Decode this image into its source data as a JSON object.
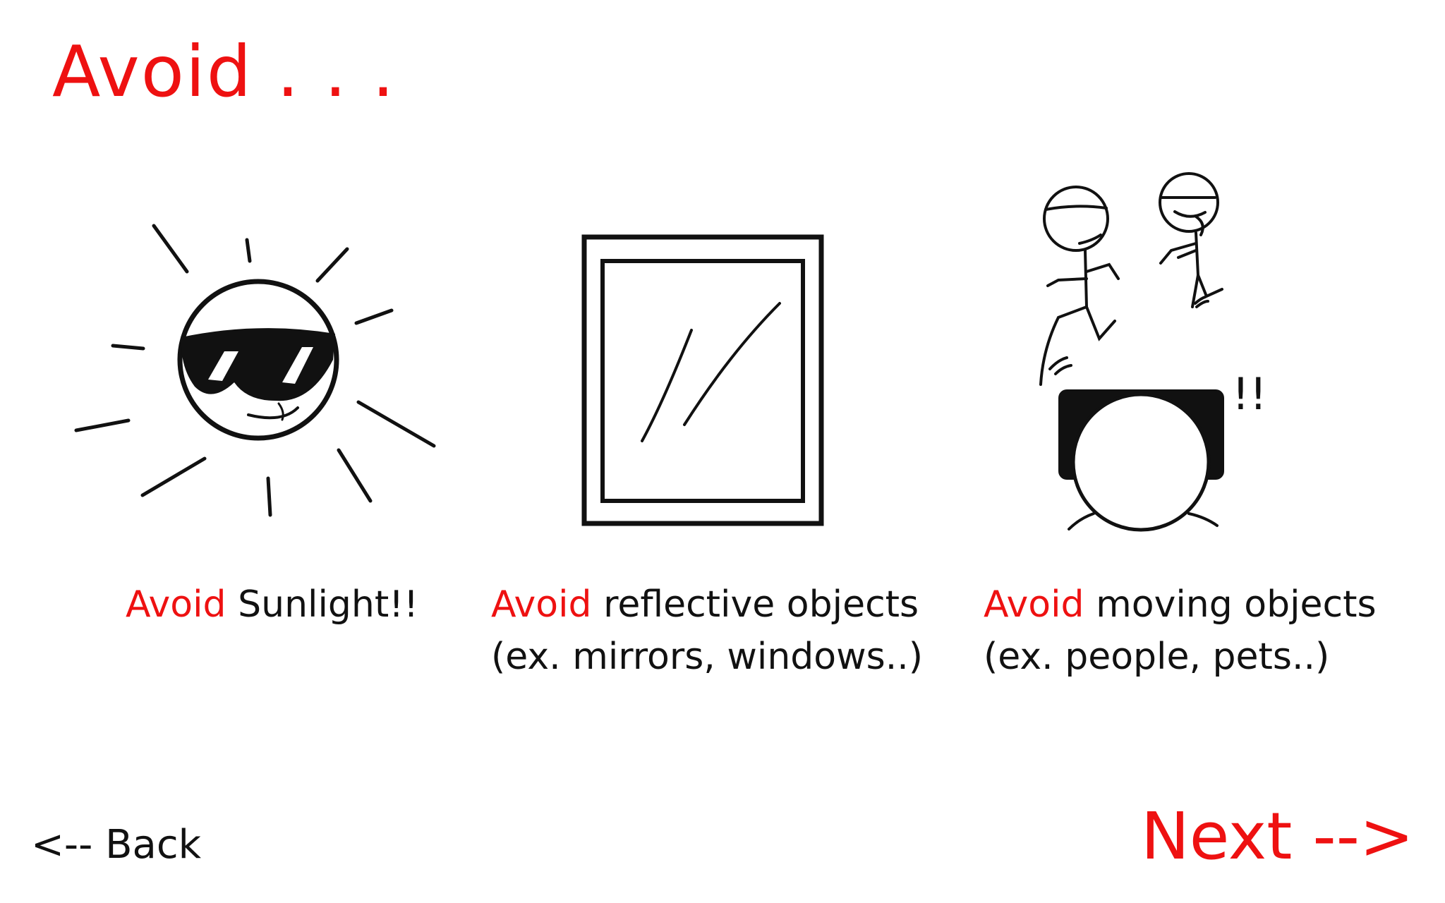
{
  "page": {
    "title": "Avoid . . ."
  },
  "items": [
    {
      "icon": "sun-with-sunglasses-icon",
      "accent": "Avoid",
      "line1": " Sunlight!!",
      "line2": ""
    },
    {
      "icon": "mirror-icon",
      "accent": "Avoid",
      "line1": " reflective objects",
      "line2": "(ex. mirrors, windows..)"
    },
    {
      "icon": "moving-people-icon",
      "accent": "Avoid",
      "line1": " moving objects",
      "line2": "(ex. people, pets..)"
    }
  ],
  "alert_mark": "!!",
  "nav": {
    "back_label": "<-- Back",
    "next_label": "Next -->"
  },
  "colors": {
    "accent": "#ee1111",
    "text": "#111111",
    "background": "#ffffff"
  }
}
